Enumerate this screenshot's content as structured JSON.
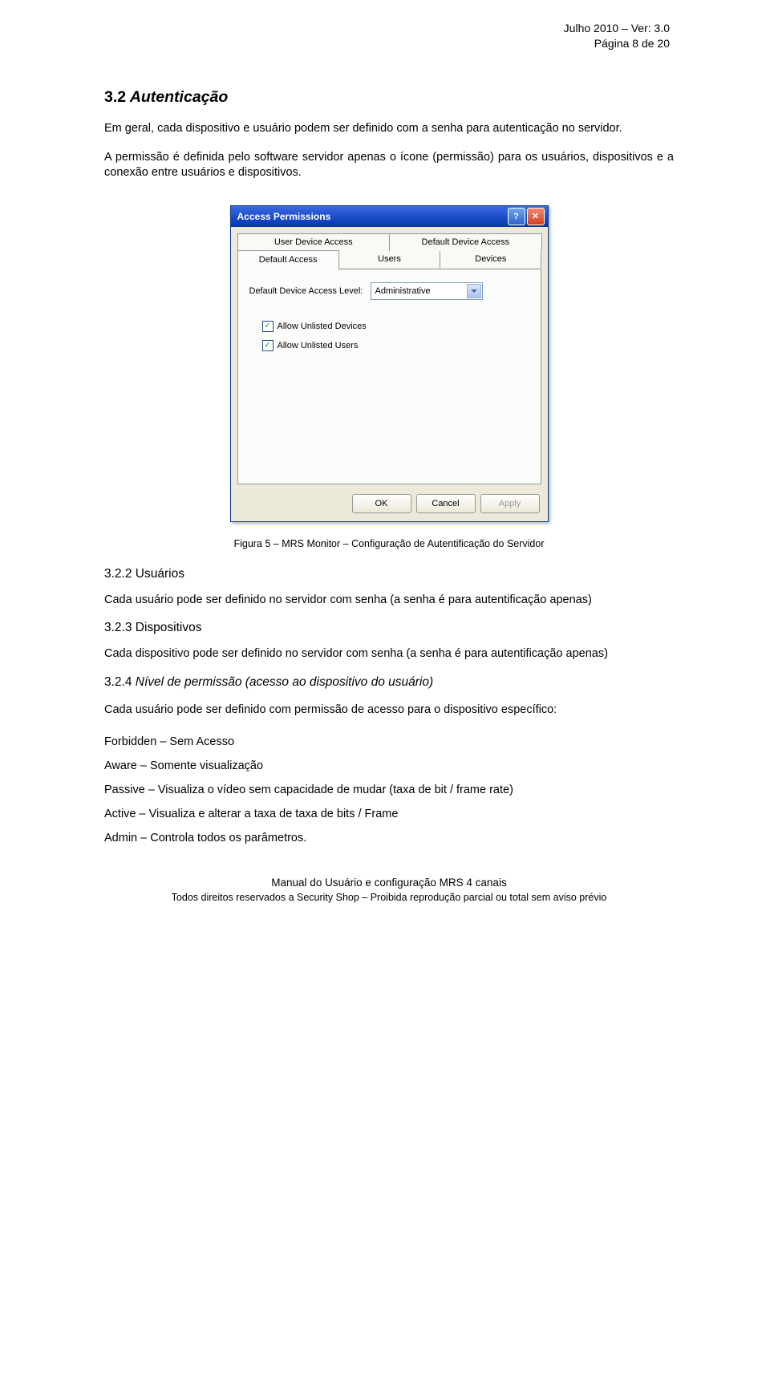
{
  "header": {
    "line1": "Julho 2010 – Ver: 3.0",
    "line2": "Página 8 de 20"
  },
  "section": {
    "number": "3.2",
    "title": "Autenticação",
    "para1": "Em geral, cada dispositivo e usuário podem ser definido com a senha para autenticação no servidor.",
    "para2": "A permissão é definida pelo software servidor apenas o ícone (permissão) para os usuários, dispositivos e a conexão entre usuários e dispositivos."
  },
  "dialog": {
    "title": "Access Permissions",
    "tabs_row1": [
      "User Device Access",
      "Default Device Access"
    ],
    "tabs_row2": [
      "Default Access",
      "Users",
      "Devices"
    ],
    "active_tab": "Default Access",
    "level_label": "Default Device Access Level:",
    "level_value": "Administrative",
    "cb1": "Allow Unlisted Devices",
    "cb2": "Allow Unlisted Users",
    "btn_ok": "OK",
    "btn_cancel": "Cancel",
    "btn_apply": "Apply"
  },
  "fig_caption": "Figura 5 – MRS Monitor – Configuração de Autentificação do Servidor",
  "s322": {
    "num": "3.2.2",
    "title": "Usuários",
    "body": "Cada usuário pode ser definido no servidor com senha (a senha é para autentificação apenas)"
  },
  "s323": {
    "num": "3.2.3",
    "title": "Dispositivos",
    "body": "Cada dispositivo pode ser definido no servidor com senha (a senha é para autentificação apenas)"
  },
  "s324": {
    "num": "3.2.4",
    "title": "Nível de permissão (acesso ao dispositivo do usuário)",
    "body": "Cada usuário pode ser definido com permissão de acesso para o dispositivo específico:",
    "items": [
      "Forbidden – Sem Acesso",
      "Aware – Somente visualização",
      "Passive – Visualiza o vídeo sem capacidade de mudar (taxa de bit / frame rate)",
      "Active – Visualiza e alterar a taxa de taxa de bits / Frame",
      "Admin – Controla todos os parâmetros."
    ]
  },
  "footer": {
    "line1": "Manual do Usuário e configuração MRS 4 canais",
    "line2": "Todos direitos reservados a Security Shop – Proibida reprodução parcial ou total sem aviso prévio"
  }
}
